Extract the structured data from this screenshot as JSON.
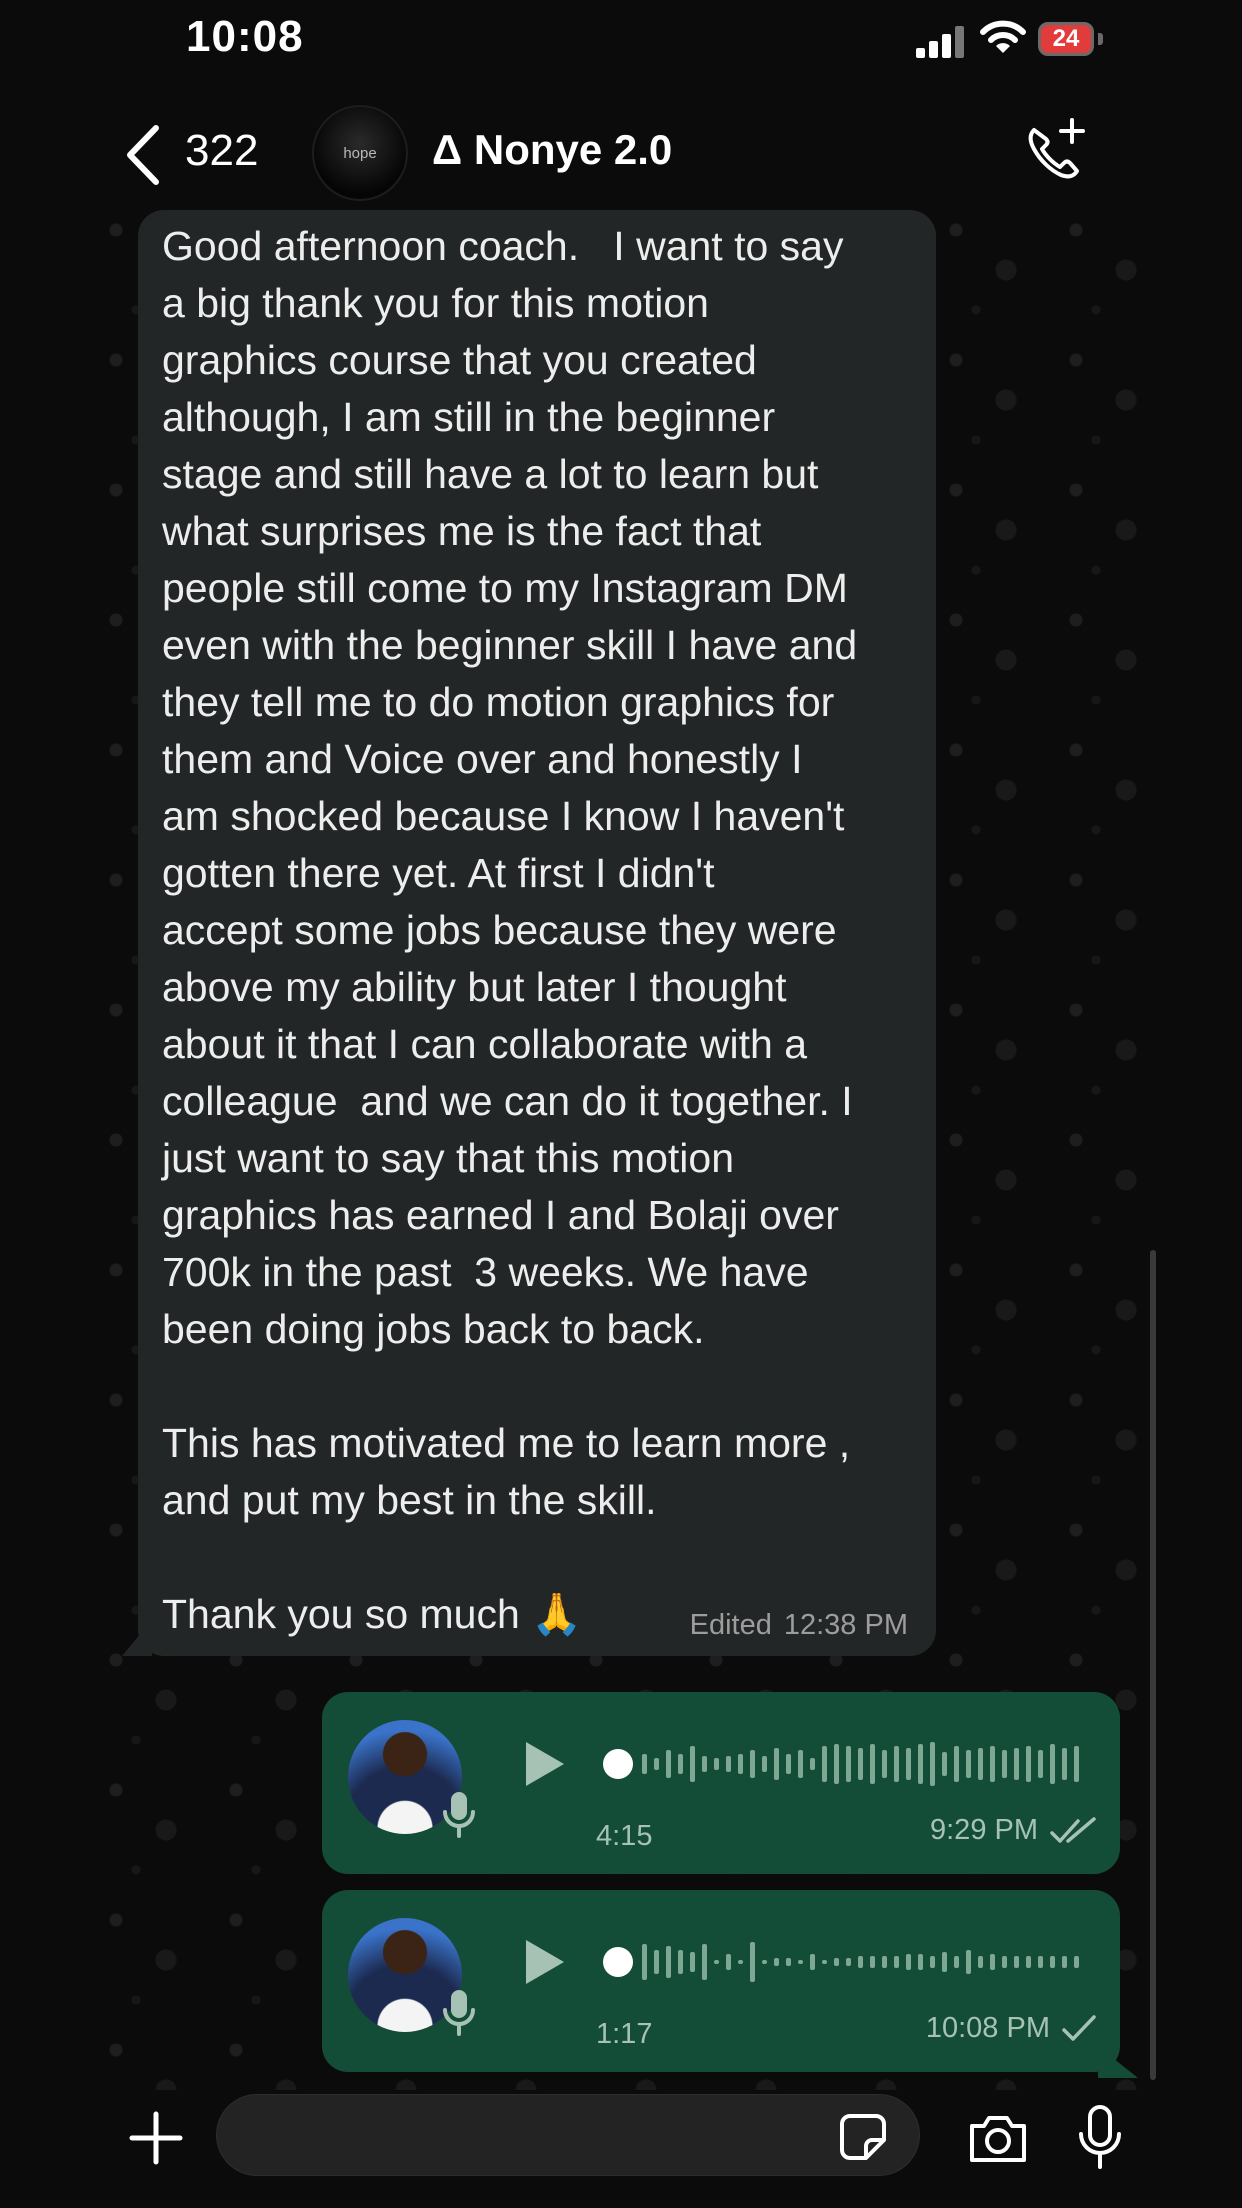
{
  "status_bar": {
    "time": "10:08",
    "battery": "24"
  },
  "header": {
    "back_count": "322",
    "avatar_text": "hope",
    "contact_name": "Δ Nonye 2.0"
  },
  "messages": {
    "incoming": {
      "text": "Good afternoon coach.   I want to say\na big thank you for this motion\ngraphics course that you created\nalthough, I am still in the beginner\nstage and still have a lot to learn but\nwhat surprises me is the fact that\npeople still come to my Instagram DM\neven with the beginner skill I have and\nthey tell me to do motion graphics for\nthem and Voice over and honestly I\nam shocked because I know I haven't\ngotten there yet. At first I didn't\naccept some jobs because they were\nabove my ability but later I thought\nabout it that I can collaborate with a\ncolleague  and we can do it together. I\njust want to say that this motion\ngraphics has earned I and Bolaji over\n700k in the past  3 weeks. We have\nbeen doing jobs back to back.\n\nThis has motivated me to learn more ,\nand put my best in the skill.\n\nThank you so much 🙏",
      "edited_label": "Edited",
      "time": "12:38 PM"
    },
    "voice_notes": [
      {
        "duration": "4:15",
        "time": "9:29 PM",
        "status": "read"
      },
      {
        "duration": "1:17",
        "time": "10:08 PM",
        "status": "sent"
      }
    ]
  },
  "input": {
    "placeholder": ""
  },
  "colors": {
    "outgoing_bubble": "#144d37",
    "incoming_bubble": "#232626",
    "accent": "#a6c2b4"
  }
}
